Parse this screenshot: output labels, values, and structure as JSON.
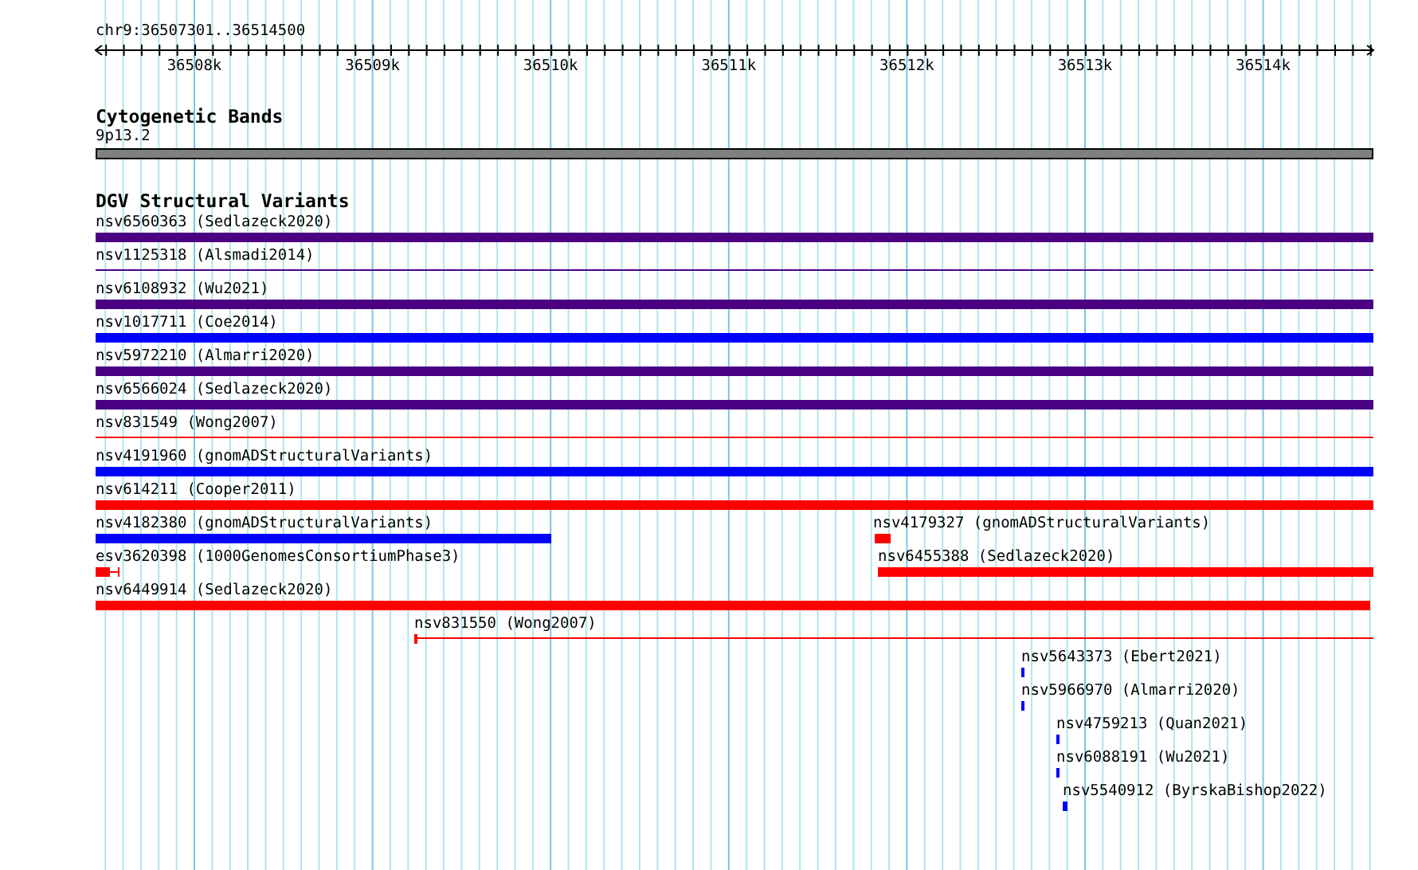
{
  "ruler": {
    "location": "chr9:36507301..36514500",
    "labels": [
      "36508k",
      "36509k",
      "36510k",
      "36511k",
      "36512k",
      "36513k",
      "36514k"
    ]
  },
  "cytogenetic_bands": {
    "title": "Cytogenetic Bands",
    "band": "9p13.2"
  },
  "structural_variants": {
    "title": "DGV Structural Variants",
    "lanes": [
      {
        "features": [
          {
            "label": "nsv6560363 (Sedlazeck2020)",
            "kind": "bar",
            "color": "#4b0082"
          }
        ]
      },
      {
        "features": [
          {
            "label": "nsv1125318 (Alsmadi2014)",
            "kind": "line",
            "color": "#4b0082"
          }
        ]
      },
      {
        "features": [
          {
            "label": "nsv6108932 (Wu2021)",
            "kind": "bar",
            "color": "#4b0082"
          }
        ]
      },
      {
        "features": [
          {
            "label": "nsv1017711 (Coe2014)",
            "kind": "bar",
            "color": "#0000ff"
          }
        ]
      },
      {
        "features": [
          {
            "label": "nsv5972210 (Almarri2020)",
            "kind": "bar",
            "color": "#4b0082"
          }
        ]
      },
      {
        "features": [
          {
            "label": "nsv6566024 (Sedlazeck2020)",
            "kind": "bar",
            "color": "#4b0082"
          }
        ]
      },
      {
        "features": [
          {
            "label": "nsv831549 (Wong2007)",
            "kind": "line",
            "color": "#ff0000"
          }
        ]
      },
      {
        "features": [
          {
            "label": "nsv4191960 (gnomADStructuralVariants)",
            "kind": "bar",
            "color": "#0000ff"
          }
        ]
      },
      {
        "features": [
          {
            "label": "nsv614211 (Cooper2011)",
            "kind": "bar",
            "color": "#ff0000"
          }
        ]
      },
      {
        "features": [
          {
            "label": "nsv4182380 (gnomADStructuralVariants)",
            "kind": "bar",
            "color": "#0000ff"
          },
          {
            "label": "nsv4179327 (gnomADStructuralVariants)",
            "kind": "bar",
            "color": "#ff0000"
          }
        ]
      },
      {
        "features": [
          {
            "label": "esv3620398 (1000GenomesConsortiumPhase3)",
            "kind": "bar",
            "color": "#ff0000"
          },
          {
            "label": "nsv6455388 (Sedlazeck2020)",
            "kind": "bar",
            "color": "#ff0000"
          }
        ]
      },
      {
        "features": [
          {
            "label": "nsv6449914 (Sedlazeck2020)",
            "kind": "bar",
            "color": "#ff0000"
          }
        ]
      },
      {
        "features": [
          {
            "label": "nsv831550 (Wong2007)",
            "kind": "line",
            "color": "#ff0000"
          }
        ]
      },
      {
        "features": [
          {
            "label": "nsv5643373 (Ebert2021)",
            "kind": "bar",
            "color": "#0000ff"
          }
        ]
      },
      {
        "features": [
          {
            "label": "nsv5966970 (Almarri2020)",
            "kind": "bar",
            "color": "#0000ff"
          }
        ]
      },
      {
        "features": [
          {
            "label": "nsv4759213 (Quan2021)",
            "kind": "bar",
            "color": "#0000ff"
          }
        ]
      },
      {
        "features": [
          {
            "label": "nsv6088191 (Wu2021)",
            "kind": "bar",
            "color": "#0000ff"
          }
        ]
      },
      {
        "features": [
          {
            "label": "nsv5540912 (ByrskaBishop2022)",
            "kind": "bar",
            "color": "#0000ff"
          }
        ]
      }
    ]
  }
}
